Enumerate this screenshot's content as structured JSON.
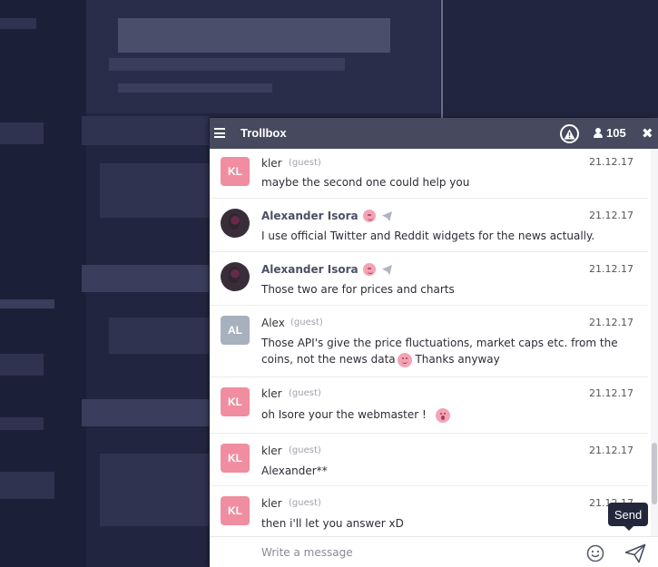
{
  "trollbox": {
    "title": "Trollbox",
    "online_count": "105",
    "menu_icon": "hamburger-menu-icon",
    "warning_icon": "warning-triangle-icon",
    "users_icon": "user-icon",
    "close_icon": "close-icon",
    "close_glyph": "✖"
  },
  "messages": [
    {
      "avatar": "KL",
      "author": "kler",
      "guest": "(guest)",
      "date": "21.12.17",
      "text": "maybe the second one could help you"
    },
    {
      "avatar": "photo",
      "author": "Alexander Isora",
      "date": "21.12.17",
      "text": "I use official Twitter and Reddit widgets for the news actually."
    },
    {
      "avatar": "photo",
      "author": "Alexander Isora",
      "date": "21.12.17",
      "text": "Those two are for prices and charts"
    },
    {
      "avatar": "AL",
      "author": "Alex",
      "guest": "(guest)",
      "date": "21.12.17",
      "text_before": "Those API's give the price fluctuations, market caps etc. from the coins, not the news data",
      "text_after": " Thanks anyway"
    },
    {
      "avatar": "KL",
      "author": "kler",
      "guest": "(guest)",
      "date": "21.12.17",
      "text": "oh Isore your the webmaster !"
    },
    {
      "avatar": "KL",
      "author": "kler",
      "guest": "(guest)",
      "date": "21.12.17",
      "text": "Alexander**"
    },
    {
      "avatar": "KL",
      "author": "kler",
      "guest": "(guest)",
      "date": "21.12.17",
      "text": "then i'll let you answer xD"
    }
  ],
  "composer": {
    "placeholder": "Write a message",
    "emoji_icon": "smiley-icon",
    "send_icon": "paper-plane-icon"
  },
  "tooltip": {
    "label": "Send"
  },
  "colors": {
    "header": "#474a5e",
    "avatar_pink": "#f08da0",
    "avatar_grey": "#a7b0bd",
    "background": "#22253f"
  }
}
